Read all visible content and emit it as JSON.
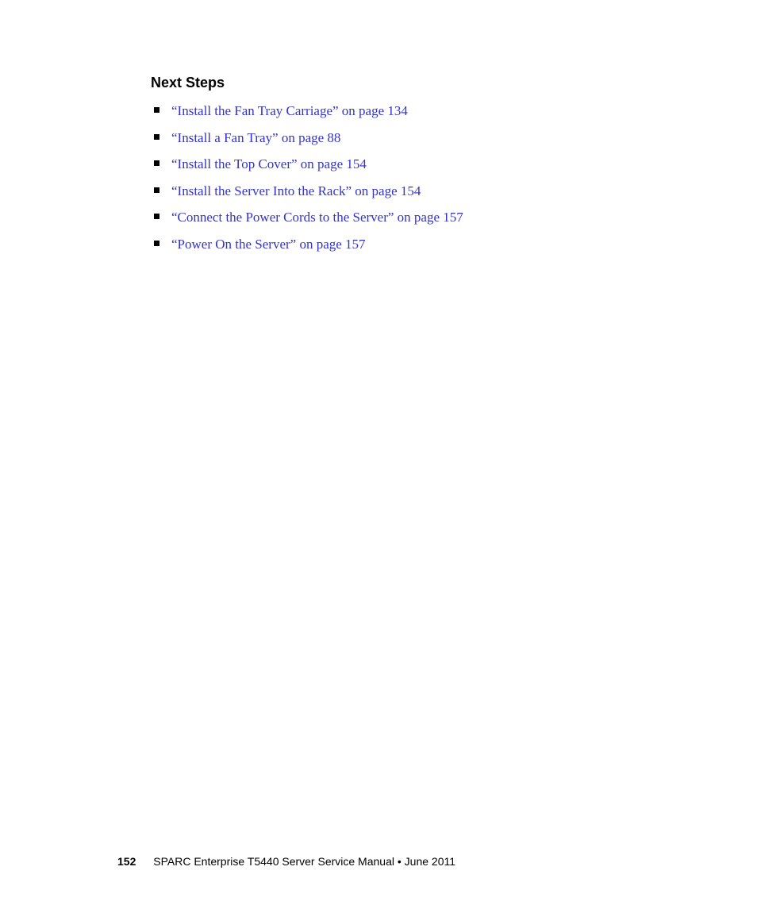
{
  "heading": "Next Steps",
  "steps": [
    "“Install the Fan Tray Carriage” on page 134",
    "“Install a Fan Tray” on page 88",
    "“Install the Top Cover” on page 154",
    "“Install the Server Into the Rack” on page 154",
    "“Connect the Power Cords to the Server” on page 157",
    "“Power On the Server” on page 157"
  ],
  "footer": {
    "page_number": "152",
    "title": "SPARC Enterprise T5440 Server Service Manual  •  June 2011"
  }
}
